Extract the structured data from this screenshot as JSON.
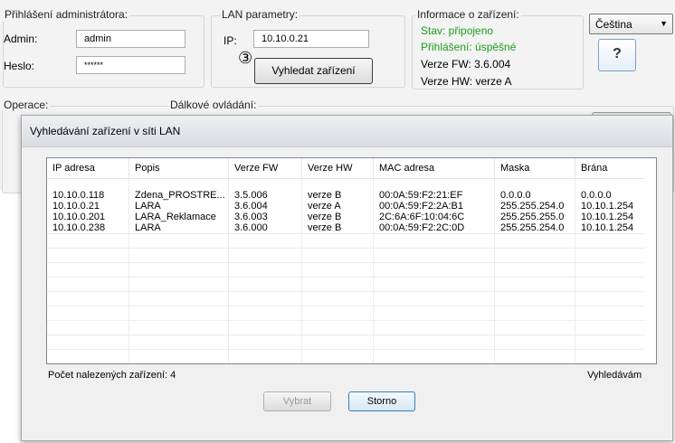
{
  "login": {
    "title": "Přihlášení administrátora:",
    "admin_label": "Admin:",
    "admin_value": "admin",
    "password_label": "Heslo:",
    "password_value": "******"
  },
  "lan": {
    "title": "LAN parametry:",
    "ip_label": "IP:",
    "ip_value": "10.10.0.21",
    "step_marker": "③",
    "search_button": "Vyhledat zařízení"
  },
  "info": {
    "title": "Informace o zařízení:",
    "status": "Stav: připojeno",
    "login_status": "Přihlášení: úspěšné",
    "fw": "Verze FW: 3.6.004",
    "hw": "Verze HW: verze A"
  },
  "language": {
    "selected": "Čeština",
    "help": "?"
  },
  "operations": {
    "title": "Operace:",
    "remote": "Dálkové ovládání:"
  },
  "dialog": {
    "title": "Vyhledávání zařízení v síti LAN",
    "columns": [
      "IP adresa",
      "Popis",
      "Verze FW",
      "Verze HW",
      "MAC adresa",
      "Maska",
      "Brána"
    ],
    "rows": [
      [
        "10.10.0.118",
        "Zdena_PROSTRE...",
        "3.5.006",
        "verze B",
        "00:0A:59:F2:21:EF",
        "0.0.0.0",
        "0.0.0.0"
      ],
      [
        "10.10.0.21",
        "LARA",
        "3.6.004",
        "verze A",
        "00:0A:59:F2:2A:B1",
        "255.255.254.0",
        "10.10.1.254"
      ],
      [
        "10.10.0.201",
        "LARA_Reklamace",
        "3.6.003",
        "verze B",
        "2C:6A:6F:10:04:6C",
        "255.255.255.0",
        "10.10.1.254"
      ],
      [
        "10.10.0.238",
        "LARA",
        "3.6.000",
        "verze B",
        "00:0A:59:F2:2C:0D",
        "255.255.254.0",
        "10.10.1.254"
      ]
    ],
    "found_count": "Počet nalezených zařízení: 4",
    "searching": "Vyhledávám",
    "select_button": "Vybrat",
    "cancel_button": "Storno"
  }
}
